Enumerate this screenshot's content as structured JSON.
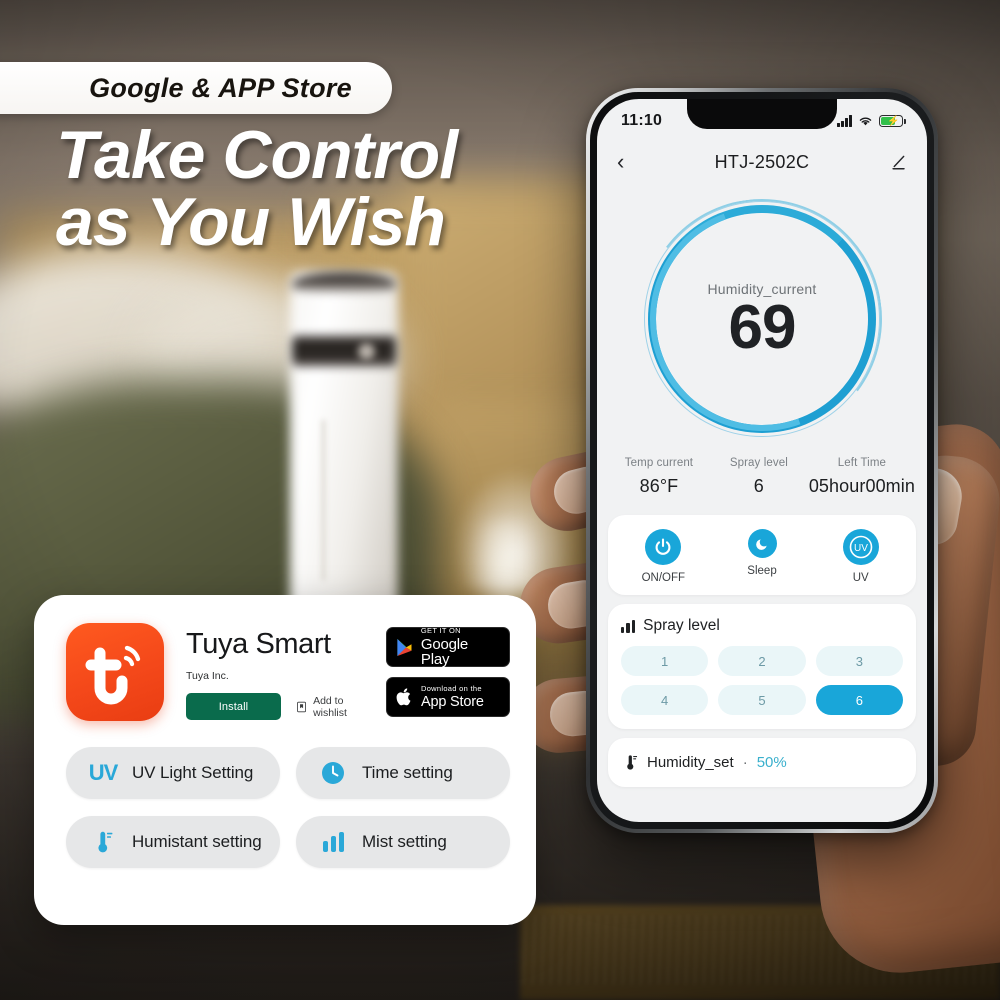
{
  "hero": {
    "badge": "Google & APP Store",
    "headline_line1": "Take Control",
    "headline_line2": "as You Wish"
  },
  "colors": {
    "accent_blue": "#19a6d9",
    "gauge_blue": "#1e9fd2",
    "tuya_orange": "#f4481a",
    "install_green": "#0a6b4c",
    "humidity_teal": "#3ab0cd"
  },
  "phone": {
    "statusbar": {
      "time": "11:10",
      "signal_icon": "signal-bars-icon",
      "wifi_icon": "wifi-icon",
      "battery_icon": "battery-charging-icon"
    },
    "navbar": {
      "back_icon": "chevron-left-icon",
      "title": "HTJ-2502C",
      "edit_icon": "pencil-edit-icon"
    },
    "gauge": {
      "label": "Humidity_current",
      "value": "69"
    },
    "stats": [
      {
        "label": "Temp current",
        "value": "86°F"
      },
      {
        "label": "Spray level",
        "value": "6"
      },
      {
        "label": "Left Time",
        "value": "05hour00min"
      }
    ],
    "controls": [
      {
        "label": "ON/OFF",
        "icon": "power-icon"
      },
      {
        "label": "Sleep",
        "icon": "moon-sleep-icon"
      },
      {
        "label": "UV",
        "icon": "uv-icon"
      }
    ],
    "spray": {
      "icon": "signal-bars-icon",
      "title": "Spray level",
      "levels": [
        "1",
        "2",
        "3",
        "4",
        "5",
        "6"
      ],
      "selected": "6"
    },
    "humidity_set": {
      "icon": "thermometer-icon",
      "label": "Humidity_set",
      "separator": "·",
      "value": "50%"
    }
  },
  "promo": {
    "app_icon": "tuya-logo-icon",
    "app_name": "Tuya Smart",
    "developer": "Tuya Inc.",
    "install_label": "Install",
    "wishlist_icon": "bookmark-icon",
    "wishlist_label": "Add to wishlist",
    "badges": [
      {
        "icon": "google-play-icon",
        "top": "GET IT ON",
        "bottom": "Google Play"
      },
      {
        "icon": "apple-icon",
        "top": "Download on the",
        "bottom": "App Store"
      }
    ],
    "features": [
      {
        "icon": "uv-icon",
        "label": "UV Light Setting"
      },
      {
        "icon": "clock-icon",
        "label": "Time setting"
      },
      {
        "icon": "thermometer-icon",
        "label": "Humistant setting"
      },
      {
        "icon": "bars-icon",
        "label": "Mist setting"
      }
    ]
  }
}
